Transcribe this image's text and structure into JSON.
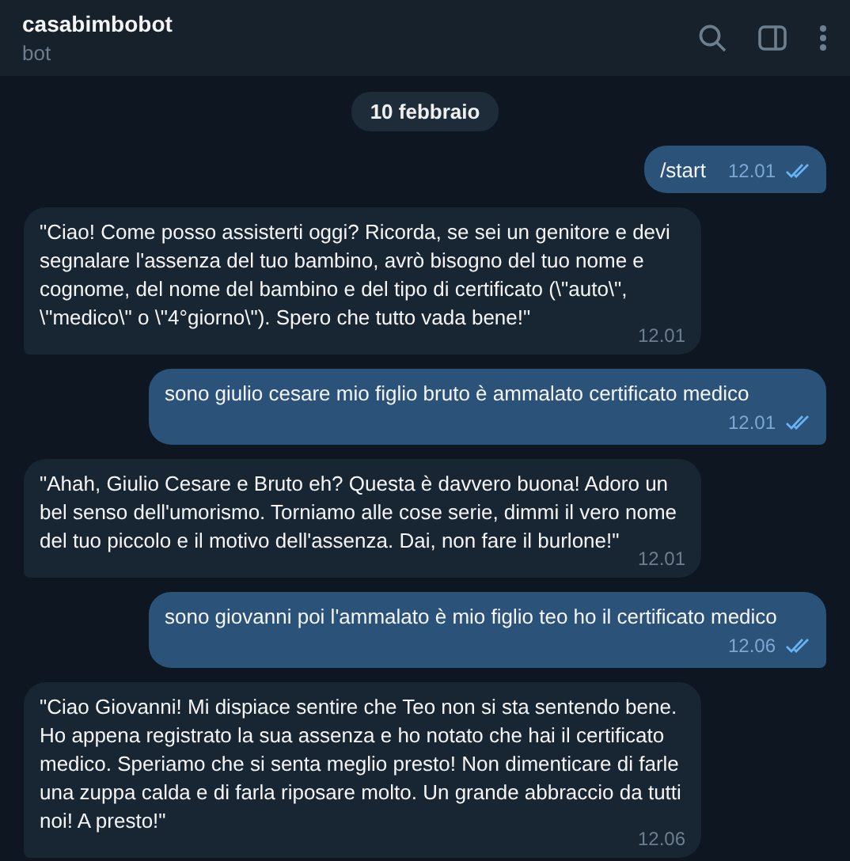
{
  "header": {
    "title": "casabimbobot",
    "subtitle": "bot"
  },
  "date": "10 febbraio",
  "messages": [
    {
      "kind": "out",
      "text": "/start",
      "time": "12.01",
      "read": true
    },
    {
      "kind": "in",
      "text": "\"Ciao! Come posso assisterti oggi? Ricorda, se sei un genitore e devi segnalare l'assenza del tuo bambino, avrò bisogno del tuo nome e cognome, del nome del bambino e del tipo di certificato (\\\"auto\\\", \\\"medico\\\" o \\\"4°giorno\\\"). Spero che tutto vada bene!\"",
      "time": "12.01"
    },
    {
      "kind": "out",
      "text": "sono giulio cesare mio figlio bruto è ammalato certificato medico",
      "time": "12.01",
      "read": true
    },
    {
      "kind": "in",
      "text": "\"Ahah, Giulio Cesare e Bruto eh? Questa è davvero buona! Adoro un bel senso dell'umorismo. Torniamo alle cose serie, dimmi il vero nome del tuo piccolo e il motivo dell'assenza. Dai, non fare il burlone!\"",
      "time": "12.01"
    },
    {
      "kind": "out",
      "text": "sono giovanni poi l'ammalato è mio figlio teo ho il certificato medico",
      "time": "12.06",
      "read": true
    },
    {
      "kind": "in",
      "text": "\"Ciao Giovanni! Mi dispiace sentire che Teo non si sta sentendo bene. Ho appena registrato la sua assenza e ho notato che hai il certificato medico. Speriamo che si senta meglio presto! Non dimenticare di farle una zuppa calda e di farla riposare molto. Un grande abbraccio da tutti noi! A presto!\"",
      "time": "12.06"
    }
  ]
}
